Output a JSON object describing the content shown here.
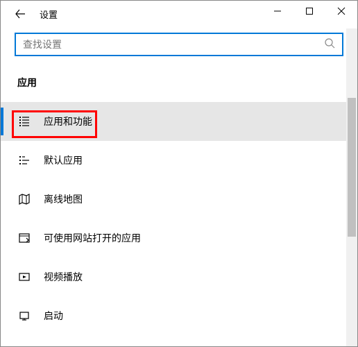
{
  "titlebar": {
    "title": "设置"
  },
  "search": {
    "placeholder": "查找设置"
  },
  "section": {
    "header": "应用"
  },
  "nav": {
    "items": [
      {
        "label": "应用和功能",
        "icon": "apps-features-icon",
        "selected": true
      },
      {
        "label": "默认应用",
        "icon": "default-apps-icon",
        "selected": false
      },
      {
        "label": "离线地图",
        "icon": "offline-maps-icon",
        "selected": false
      },
      {
        "label": "可使用网站打开的应用",
        "icon": "website-apps-icon",
        "selected": false
      },
      {
        "label": "视频播放",
        "icon": "video-playback-icon",
        "selected": false
      },
      {
        "label": "启动",
        "icon": "startup-icon",
        "selected": false
      }
    ]
  }
}
